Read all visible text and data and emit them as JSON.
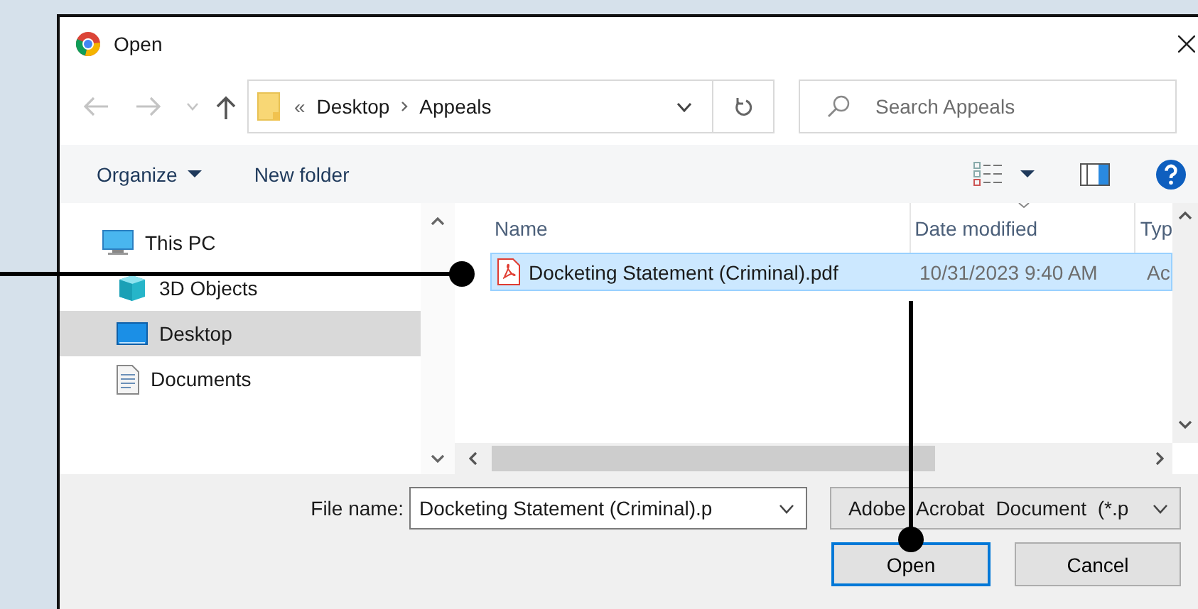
{
  "window": {
    "title": "Open"
  },
  "address": {
    "overflow": "«",
    "path": [
      "Desktop",
      "Appeals"
    ]
  },
  "search": {
    "placeholder": "Search Appeals"
  },
  "toolbar": {
    "organize": "Organize",
    "new_folder": "New folder"
  },
  "sidebar": {
    "items": [
      {
        "label": "This PC",
        "kind": "pc",
        "selected": false,
        "children": [
          {
            "label": "3D Objects",
            "kind": "objects3d",
            "selected": false
          },
          {
            "label": "Desktop",
            "kind": "desktop",
            "selected": true
          },
          {
            "label": "Documents",
            "kind": "documents",
            "selected": false
          }
        ]
      }
    ]
  },
  "table": {
    "columns": [
      "Name",
      "Date modified",
      "Typ"
    ],
    "rows": [
      {
        "cells": [
          "Docketing Statement (Criminal).pdf",
          "10/31/2023 9:40 AM",
          "Ac"
        ],
        "selected": true
      }
    ]
  },
  "file_name": {
    "label": "File name:",
    "value": "Docketing Statement (Criminal).p"
  },
  "file_type": {
    "value": "Adobe Acrobat Document (*.p"
  },
  "buttons": [
    {
      "label": "Open",
      "default": true
    },
    {
      "label": "Cancel",
      "default": false
    }
  ]
}
